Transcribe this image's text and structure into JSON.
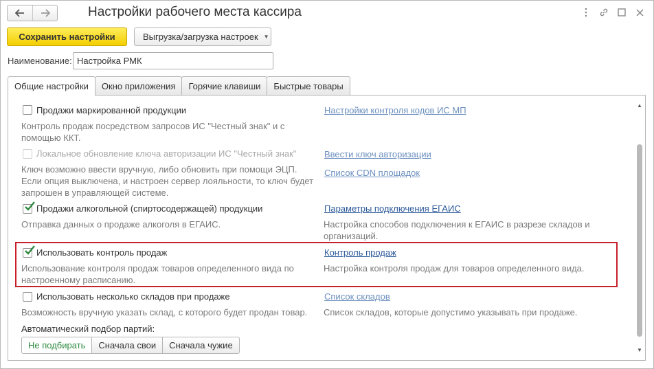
{
  "window": {
    "title": "Настройки рабочего места кассира"
  },
  "toolbar": {
    "save_label": "Сохранить настройки",
    "export_import_label": "Выгрузка/загрузка настроек"
  },
  "name_field": {
    "label": "Наименование:",
    "value": "Настройка РМК"
  },
  "tabs": [
    {
      "label": "Общие настройки",
      "active": true
    },
    {
      "label": "Окно приложения",
      "active": false
    },
    {
      "label": "Горячие клавиши",
      "active": false
    },
    {
      "label": "Быстрые товары",
      "active": false
    }
  ],
  "options": [
    {
      "label": "Продажи маркированной продукции",
      "checked": false,
      "enabled": true,
      "description": [
        "Контроль продаж посредством запросов ИС \"Честный знак\" и с",
        "помощью ККТ."
      ],
      "links": [
        {
          "text": "Настройки контроля кодов ИС МП"
        }
      ],
      "link_description": []
    },
    {
      "label": "Локальное обновление ключа авторизации ИС \"Честный знак\"",
      "checked": false,
      "enabled": false,
      "description": [
        "Ключ возможно ввести вручную, либо обновить при помощи ЭЦП.",
        "Если опция выключена, и настроен сервер лояльности, то ключ будет",
        "запрошен в управляющей системе."
      ],
      "links": [
        {
          "text": "Ввести ключ авторизации"
        },
        {
          "text": "Список CDN площадок"
        }
      ],
      "link_description": []
    },
    {
      "label": "Продажи алкогольной (спиртосодержащей) продукции",
      "checked": true,
      "enabled": true,
      "description": [
        "Отправка данных о продаже алкоголя в ЕГАИС."
      ],
      "links": [
        {
          "text": "Параметры подключения ЕГАИС"
        }
      ],
      "link_description": [
        "Настройка способов подключения к ЕГАИС в разрезе складов и",
        "организаций."
      ]
    },
    {
      "label": "Использовать контроль продаж",
      "checked": true,
      "enabled": true,
      "description": [
        "Использование контроля продаж товаров определенного вида по",
        "настроенному расписанию."
      ],
      "links": [
        {
          "text": "Контроль продаж"
        }
      ],
      "link_description": [
        "Настройка контроля продаж для товаров определенного вида."
      ]
    },
    {
      "label": "Использовать несколько складов при продаже",
      "checked": false,
      "enabled": true,
      "description": [
        "Возможность вручную указать склад, с которого будет продан товар."
      ],
      "links": [
        {
          "text": "Список складов"
        }
      ],
      "link_description": [
        "Список складов, которые допустимо указывать при продаже."
      ]
    }
  ],
  "batch_selection": {
    "label": "Автоматический подбор партий:",
    "options": [
      {
        "label": "Не подбирать",
        "active": true
      },
      {
        "label": "Сначала свои",
        "active": false
      },
      {
        "label": "Сначала чужие",
        "active": false
      }
    ]
  },
  "icons": {
    "back": "arrow-left-icon",
    "forward": "arrow-right-icon",
    "more": "more-vertical-icon",
    "link": "link-icon",
    "maximize": "maximize-icon",
    "close": "close-icon"
  },
  "colors": {
    "primary_button": "#f3cf00",
    "link": "#6b8fbf",
    "link_strong": "#2d5a9a",
    "check_green": "#2e8b3e",
    "highlight_border": "#c8202a"
  }
}
